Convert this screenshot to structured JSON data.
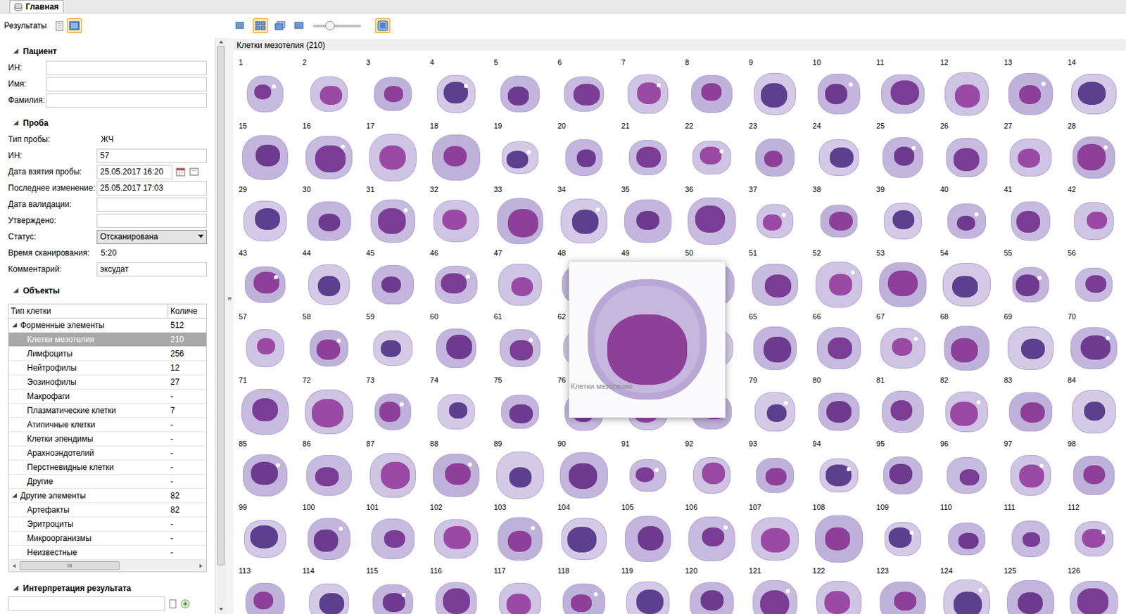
{
  "tabs": [
    {
      "label": "Главная",
      "selected": true
    }
  ],
  "toolbar": {
    "label": "Результаты",
    "view_buttons": [
      {
        "selected": false
      },
      {
        "selected": true
      }
    ],
    "layout_buttons": [
      {
        "selected": false
      },
      {
        "selected": true
      },
      {
        "selected": false
      },
      {
        "selected": false
      }
    ],
    "zoom": {
      "level": 0.35
    },
    "fit_button": {
      "selected": true
    }
  },
  "expand_glyph": "◢",
  "splitter_grip": "≡",
  "hscroll_grip": "III",
  "patient": {
    "title": "Пациент",
    "expanded": true,
    "fields": [
      {
        "label": "ИН:",
        "value": ""
      },
      {
        "label": "Имя:",
        "value": ""
      },
      {
        "label": "Фамилия:",
        "value": ""
      }
    ]
  },
  "sample": {
    "title": "Проба",
    "expanded": true,
    "fields": [
      {
        "label": "Тип пробы:",
        "value": "ЖЧ",
        "kind": "text"
      },
      {
        "label": "ИН:",
        "value": "57",
        "kind": "input"
      },
      {
        "label": "Дата взятия пробы:",
        "value": "25.05.2017 16:20",
        "kind": "date"
      },
      {
        "label": "Последнее изменение:",
        "value": "25.05.2017 17:03",
        "kind": "input"
      },
      {
        "label": "Дата валидации:",
        "value": "",
        "kind": "input"
      },
      {
        "label": "Утверждено:",
        "value": "",
        "kind": "input"
      },
      {
        "label": "Статус:",
        "value": "Отсканирована",
        "kind": "select"
      },
      {
        "label": "Время сканирования:",
        "value": "5:20",
        "kind": "text"
      },
      {
        "label": "Комментарий:",
        "value": "эксудат",
        "kind": "input"
      }
    ]
  },
  "objects": {
    "title": "Объекты",
    "expanded": true,
    "columns": [
      "Тип клетки",
      "Количе"
    ],
    "rows": [
      {
        "name": "Форменные элементы",
        "count": "512",
        "kind": "group",
        "expanded": true,
        "selected": false
      },
      {
        "name": "Клетки мезотелия",
        "count": "210",
        "kind": "item",
        "expanded": false,
        "selected": true
      },
      {
        "name": "Лимфоциты",
        "count": "256",
        "kind": "item",
        "expanded": false,
        "selected": false
      },
      {
        "name": "Нейтрофилы",
        "count": "12",
        "kind": "item",
        "expanded": false,
        "selected": false
      },
      {
        "name": "Эозинофилы",
        "count": "27",
        "kind": "item",
        "expanded": false,
        "selected": false
      },
      {
        "name": "Макрофаги",
        "count": "-",
        "kind": "item",
        "expanded": false,
        "selected": false
      },
      {
        "name": "Плазматические клетки",
        "count": "7",
        "kind": "item",
        "expanded": false,
        "selected": false
      },
      {
        "name": "Атипичные клетки",
        "count": "-",
        "kind": "item",
        "expanded": false,
        "selected": false
      },
      {
        "name": "Клетки эпендимы",
        "count": "-",
        "kind": "item",
        "expanded": false,
        "selected": false
      },
      {
        "name": "Арахноэндотелий",
        "count": "-",
        "kind": "item",
        "expanded": false,
        "selected": false
      },
      {
        "name": "Перстневидные клетки",
        "count": "-",
        "kind": "item",
        "expanded": false,
        "selected": false
      },
      {
        "name": "Другие",
        "count": "-",
        "kind": "item",
        "expanded": false,
        "selected": false
      },
      {
        "name": "Другие элементы",
        "count": "82",
        "kind": "group",
        "expanded": true,
        "selected": false
      },
      {
        "name": "Артефакты",
        "count": "82",
        "kind": "item",
        "expanded": false,
        "selected": false
      },
      {
        "name": "Эритроциты",
        "count": "-",
        "kind": "item",
        "expanded": false,
        "selected": false
      },
      {
        "name": "Микроорганизмы",
        "count": "-",
        "kind": "item",
        "expanded": false,
        "selected": false
      },
      {
        "name": "Неизвестные",
        "count": "-",
        "kind": "item",
        "expanded": false,
        "selected": false
      }
    ]
  },
  "interpretation": {
    "title": "Интерпретация результата",
    "expanded": true,
    "value": ""
  },
  "gallery": {
    "title": "Клетки мезотелия (210)",
    "cells": [
      {
        "number": "1"
      },
      {
        "number": "2"
      },
      {
        "number": "3"
      },
      {
        "number": "4"
      },
      {
        "number": "5"
      },
      {
        "number": "6"
      },
      {
        "number": "7"
      },
      {
        "number": "8"
      },
      {
        "number": "9"
      },
      {
        "number": "10"
      },
      {
        "number": "11"
      },
      {
        "number": "12"
      },
      {
        "number": "13"
      },
      {
        "number": "14"
      },
      {
        "number": "15"
      },
      {
        "number": "16"
      },
      {
        "number": "17"
      },
      {
        "number": "18"
      },
      {
        "number": "19"
      },
      {
        "number": "20"
      },
      {
        "number": "21"
      },
      {
        "number": "22"
      },
      {
        "number": "23"
      },
      {
        "number": "24"
      },
      {
        "number": "25"
      },
      {
        "number": "26"
      },
      {
        "number": "27"
      },
      {
        "number": "28"
      },
      {
        "number": "29"
      },
      {
        "number": "30"
      },
      {
        "number": "31"
      },
      {
        "number": "32"
      },
      {
        "number": "33"
      },
      {
        "number": "34"
      },
      {
        "number": "35"
      },
      {
        "number": "36"
      },
      {
        "number": "37"
      },
      {
        "number": "38"
      },
      {
        "number": "39"
      },
      {
        "number": "40"
      },
      {
        "number": "41"
      },
      {
        "number": "42"
      },
      {
        "number": "43"
      },
      {
        "number": "44"
      },
      {
        "number": "45"
      },
      {
        "number": "46"
      },
      {
        "number": "47"
      },
      {
        "number": "48"
      },
      {
        "number": "49"
      },
      {
        "number": "50"
      },
      {
        "number": "51"
      },
      {
        "number": "52"
      },
      {
        "number": "53"
      },
      {
        "number": "54"
      },
      {
        "number": "55"
      },
      {
        "number": "56"
      },
      {
        "number": "57"
      },
      {
        "number": "58"
      },
      {
        "number": "59"
      },
      {
        "number": "60"
      },
      {
        "number": "61"
      },
      {
        "number": "62"
      },
      {
        "covered": true
      },
      {
        "covered": true
      },
      {
        "number": "65"
      },
      {
        "number": "66"
      },
      {
        "number": "67"
      },
      {
        "number": "68"
      },
      {
        "number": "69"
      },
      {
        "number": "70"
      },
      {
        "number": "71"
      },
      {
        "number": "72"
      },
      {
        "number": "73"
      },
      {
        "number": "74"
      },
      {
        "number": "75"
      },
      {
        "number": "76"
      },
      {
        "covered": true
      },
      {
        "covered": true
      },
      {
        "number": "79"
      },
      {
        "number": "80"
      },
      {
        "number": "81"
      },
      {
        "number": "82"
      },
      {
        "number": "83"
      },
      {
        "number": "84"
      },
      {
        "number": "85"
      },
      {
        "number": "86"
      },
      {
        "number": "87"
      },
      {
        "number": "88"
      },
      {
        "number": "89"
      },
      {
        "number": "90"
      },
      {
        "number": "91"
      },
      {
        "number": "92"
      },
      {
        "number": "93"
      },
      {
        "number": "94"
      },
      {
        "number": "95"
      },
      {
        "number": "96"
      },
      {
        "number": "97"
      },
      {
        "number": "98"
      },
      {
        "number": "99"
      },
      {
        "number": "100"
      },
      {
        "number": "101"
      },
      {
        "number": "102"
      },
      {
        "number": "103"
      },
      {
        "number": "104"
      },
      {
        "number": "105"
      },
      {
        "number": "106"
      },
      {
        "number": "107"
      },
      {
        "number": "108"
      },
      {
        "number": "109"
      },
      {
        "number": "110"
      },
      {
        "number": "111"
      },
      {
        "number": "112"
      },
      {
        "number": "113"
      },
      {
        "number": "114"
      },
      {
        "number": "115"
      },
      {
        "number": "116"
      },
      {
        "number": "117"
      },
      {
        "number": "118"
      },
      {
        "number": "119"
      },
      {
        "number": "120"
      },
      {
        "number": "121"
      },
      {
        "number": "122"
      },
      {
        "number": "123"
      },
      {
        "number": "124"
      },
      {
        "number": "125"
      },
      {
        "number": "126"
      }
    ]
  },
  "preview": {
    "tooltip": "Клетки мезотелия"
  }
}
